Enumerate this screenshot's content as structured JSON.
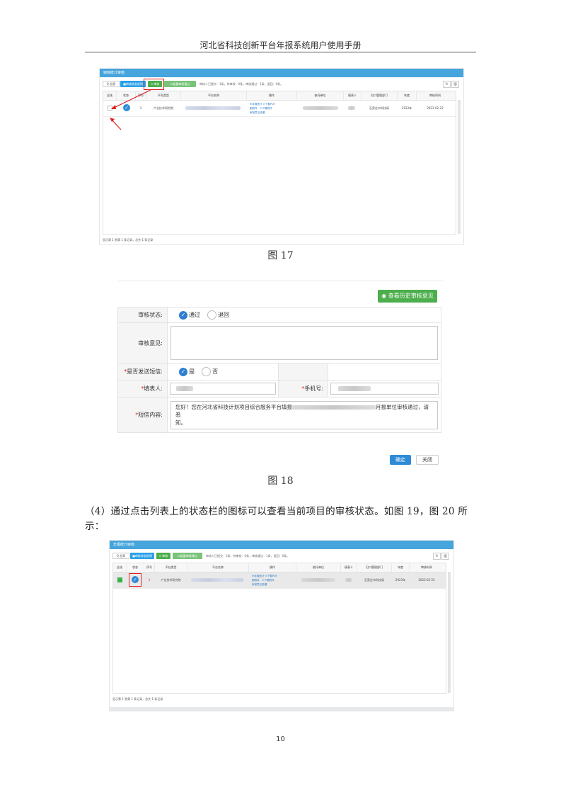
{
  "header": {
    "title": "河北省科技创新平台年报系统用户使用手册"
  },
  "figure17": {
    "caption": "图 17",
    "window_title": "审核统计审核",
    "toolbar": {
      "search": "Q 检索",
      "btn1": "■审核状态说明",
      "btn2": "⊙ 审核",
      "btn3": "☑批量审核通过",
      "stats": "审核人已提交：1条，待审核：0条，审核通过：1条，退回：0条。"
    },
    "columns": [
      "全选",
      "状态",
      "序号",
      "平台类型",
      "平台名称",
      "操作",
      "依托单位",
      "填表人",
      "归口管理部门",
      "年度",
      "审核时间"
    ],
    "row": {
      "index": "1",
      "type": "产业技术研究院",
      "ops": [
        "★年报统计",
        "⊙下载PDF",
        "图附件",
        "⊙下载附件",
        "审核意见查看"
      ],
      "dept": "石家庄市科技局",
      "year": "2023年",
      "time": "2023-02-22"
    },
    "footer": "显示第 1 到第 1 条记录，总共 1 条记录"
  },
  "figure18": {
    "caption": "图 18",
    "history_button": "查看历史审核意见",
    "status_label": "审核状态:",
    "pass": "通过",
    "reject": "退回",
    "opinion_label": "审核意见:",
    "sms_label": "是否发送短信:",
    "yes": "是",
    "no": "否",
    "filler_label": "填表人:",
    "phone_label": "手机号:",
    "sms_content_label": "短信内容:",
    "sms_text_start": "您好！您在河北省科技计划项目综合服务平台填报",
    "sms_text_end": "月报单位审核通过，请悉",
    "sms_text_line2": "知。",
    "ok": "确定",
    "close": "关闭"
  },
  "paragraph": "（4）通过点击列表上的状态栏的图标可以查看当前项目的审核状态。如图 19，图 20 所示：",
  "figure19": {
    "window_title": "年报统计审核",
    "toolbar": {
      "search": "Q 检索",
      "btn1": "■审核状态说明",
      "btn2": "⊙ 审核",
      "btn3": "☑批量审核通过",
      "stats": "审核人已提交：1条，待审核：0条，审核通过：1条，退回：0条。"
    },
    "columns": [
      "全选",
      "状态",
      "序号",
      "平台类型",
      "平台名称",
      "操作",
      "依托单位",
      "填表人",
      "归口管理部门",
      "年度",
      "审核时间"
    ],
    "row": {
      "index": "1",
      "type": "产业技术研究院",
      "ops": [
        "★年报统计",
        "⊙下载PDF",
        "图附件",
        "⊙下载附件",
        "审核意见查看"
      ],
      "dept": "石家庄市科技局",
      "year": "2023年",
      "time": "2023-02-22"
    },
    "footer": "显示第 1 到第 1 条记录，总共 1 条记录"
  },
  "page_number": "10",
  "colors": {
    "titlebar": "#45a5dc",
    "accent_green": "#4cae4c",
    "accent_blue": "#2e8bd6",
    "highlight": "#e02020"
  }
}
